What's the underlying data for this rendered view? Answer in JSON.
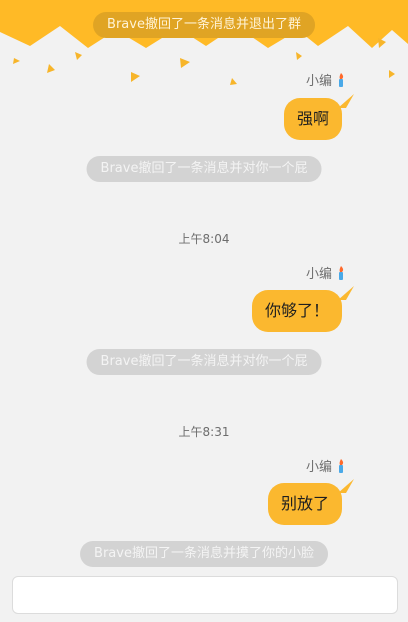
{
  "colors": {
    "accent": "#fbb82f",
    "banner": "#ffba26",
    "system_pill": "#d3d3d3",
    "background": "#f2f2f2"
  },
  "banner_notice": "Brave撤回了一条消息并退出了群",
  "messages": [
    {
      "sender": "小编",
      "sender_icon": "torch-icon",
      "text": "强啊"
    },
    {
      "system": "Brave撤回了一条消息并对你一个屁"
    },
    {
      "time": "上午8:04"
    },
    {
      "sender": "小编",
      "sender_icon": "torch-icon",
      "text": "你够了！"
    },
    {
      "system": "Brave撤回了一条消息并对你一个屁"
    },
    {
      "time": "上午8:31"
    },
    {
      "sender": "小编",
      "sender_icon": "torch-icon",
      "text": "别放了"
    },
    {
      "system": "Brave撤回了一条消息并摸了你的小脸"
    }
  ],
  "composer": {
    "value": "",
    "placeholder": ""
  }
}
